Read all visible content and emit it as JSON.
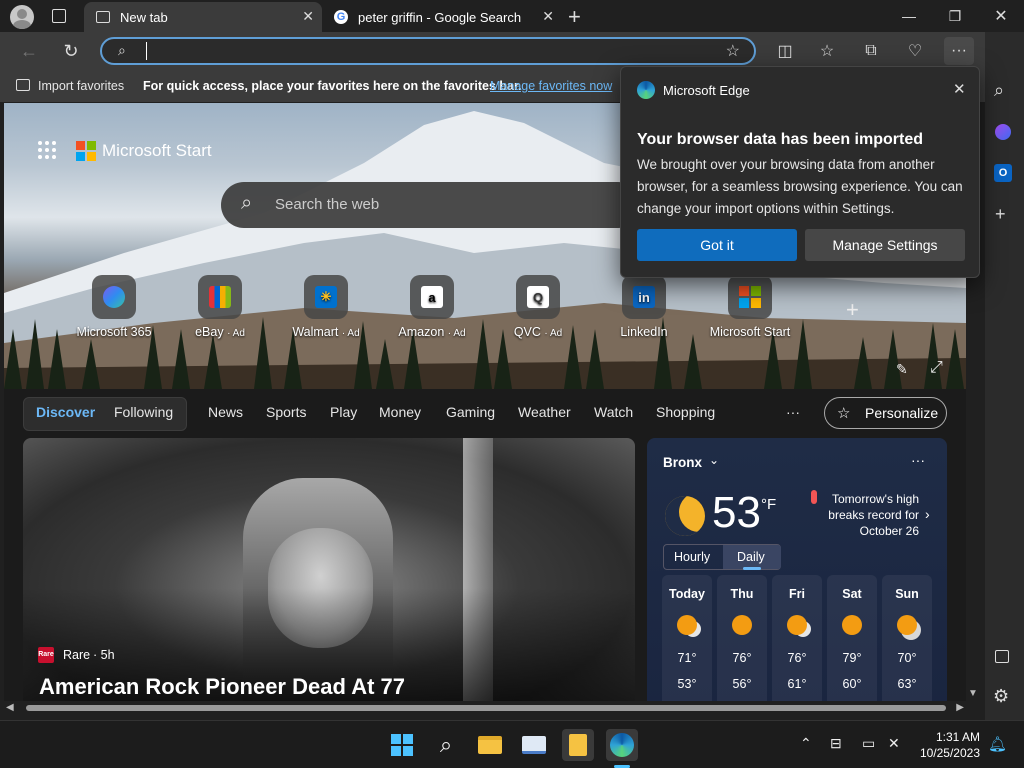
{
  "tabs": [
    {
      "title": "New tab",
      "active": true
    },
    {
      "title": "peter griffin - Google Search",
      "active": false
    }
  ],
  "address": {
    "value": "",
    "placeholder": ""
  },
  "favorites_bar": {
    "import_label": "Import favorites",
    "message": "For quick access, place your favorites here on the favorites bar.",
    "manage_link": "Manage favorites now"
  },
  "start": {
    "brand": "Microsoft Start",
    "search_placeholder": "Search the web"
  },
  "quick_links": [
    {
      "label": "Microsoft 365",
      "ad": ""
    },
    {
      "label": "eBay",
      "ad": "· Ad"
    },
    {
      "label": "Walmart",
      "ad": "· Ad"
    },
    {
      "label": "Amazon",
      "ad": "· Ad"
    },
    {
      "label": "QVC",
      "ad": "· Ad"
    },
    {
      "label": "LinkedIn",
      "ad": ""
    },
    {
      "label": "Microsoft Start",
      "ad": ""
    }
  ],
  "nav": {
    "items": [
      "Discover",
      "Following",
      "News",
      "Sports",
      "Play",
      "Money",
      "Gaming",
      "Weather",
      "Watch",
      "Shopping"
    ],
    "more": "···",
    "personalize": "Personalize"
  },
  "news": {
    "source": "Rare",
    "age": "· 5h",
    "headline": "American Rock Pioneer Dead At 77"
  },
  "weather": {
    "location": "Bronx",
    "temp": "53",
    "unit": "°F",
    "alert_line1": "Tomorrow's high",
    "alert_line2": "breaks record for",
    "alert_line3": "October 26",
    "tabs": [
      "Hourly",
      "Daily"
    ],
    "days": [
      {
        "name": "Today",
        "high": "71°",
        "low": "53°"
      },
      {
        "name": "Thu",
        "high": "76°",
        "low": "56°"
      },
      {
        "name": "Fri",
        "high": "76°",
        "low": "61°"
      },
      {
        "name": "Sat",
        "high": "79°",
        "low": "60°"
      },
      {
        "name": "Sun",
        "high": "70°",
        "low": "63°"
      }
    ]
  },
  "popup": {
    "app_name": "Microsoft Edge",
    "heading": "Your browser data has been imported",
    "body": "We brought over your browsing data from another browser, for a seamless browsing experience. You can change your import options within Settings.",
    "primary_button": "Got it",
    "secondary_button": "Manage Settings"
  },
  "clock": {
    "time": "1:31 AM",
    "date": "10/25/2023"
  },
  "colors": {
    "accent": "#0f6cbd",
    "link": "#6cb8f6",
    "focus_ring": "#5f9ed6"
  }
}
